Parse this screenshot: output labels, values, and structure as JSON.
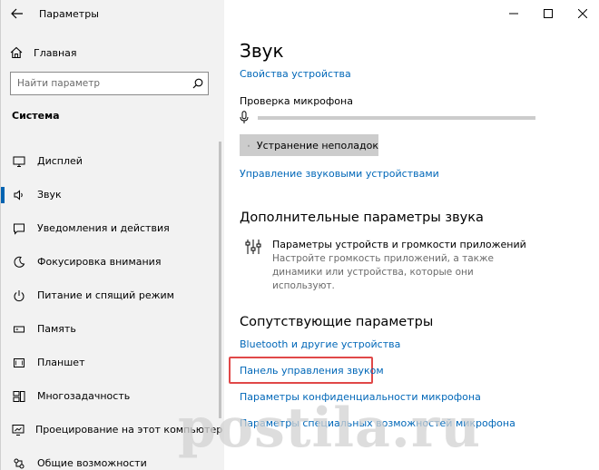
{
  "app": {
    "title": "Параметры"
  },
  "sidebar": {
    "home_label": "Главная",
    "search_placeholder": "Найти параметр",
    "section_title": "Система",
    "items": [
      {
        "label": "Дисплей",
        "icon": "monitor-icon"
      },
      {
        "label": "Звук",
        "icon": "speaker-icon",
        "selected": true
      },
      {
        "label": "Уведомления и действия",
        "icon": "notification-icon"
      },
      {
        "label": "Фокусировка внимания",
        "icon": "moon-icon"
      },
      {
        "label": "Питание и спящий режим",
        "icon": "power-icon"
      },
      {
        "label": "Память",
        "icon": "storage-icon"
      },
      {
        "label": "Планшет",
        "icon": "tablet-icon"
      },
      {
        "label": "Многозадачность",
        "icon": "multitasking-icon"
      },
      {
        "label": "Проецирование на этот компьютер",
        "icon": "projection-icon"
      },
      {
        "label": "Общие возможности",
        "icon": "shared-experiences-icon"
      }
    ]
  },
  "main": {
    "title": "Звук",
    "device_properties_link": "Свойства устройства",
    "mic_test_label": "Проверка микрофона",
    "mic_level": 0,
    "troubleshoot_button": "Устранение неполадок",
    "manage_devices_link": "Управление звуковыми устройствами",
    "advanced_heading": "Дополнительные параметры звука",
    "advanced_item": {
      "title": "Параметры устройств и громкости приложений",
      "description": "Настройте громкость приложений, а также динамики или устройства, которые они используют."
    },
    "related_heading": "Сопутствующие параметры",
    "related_links": [
      "Bluetooth и другие устройства",
      "Панель управления звуком",
      "Параметры конфиденциальности микрофона",
      "Параметры специальных возможностей микрофона"
    ]
  },
  "watermark": "postila.ru",
  "colors": {
    "accent": "#0067b8",
    "sidebar_bg": "#f2f2f2",
    "highlight": "#e04848"
  }
}
